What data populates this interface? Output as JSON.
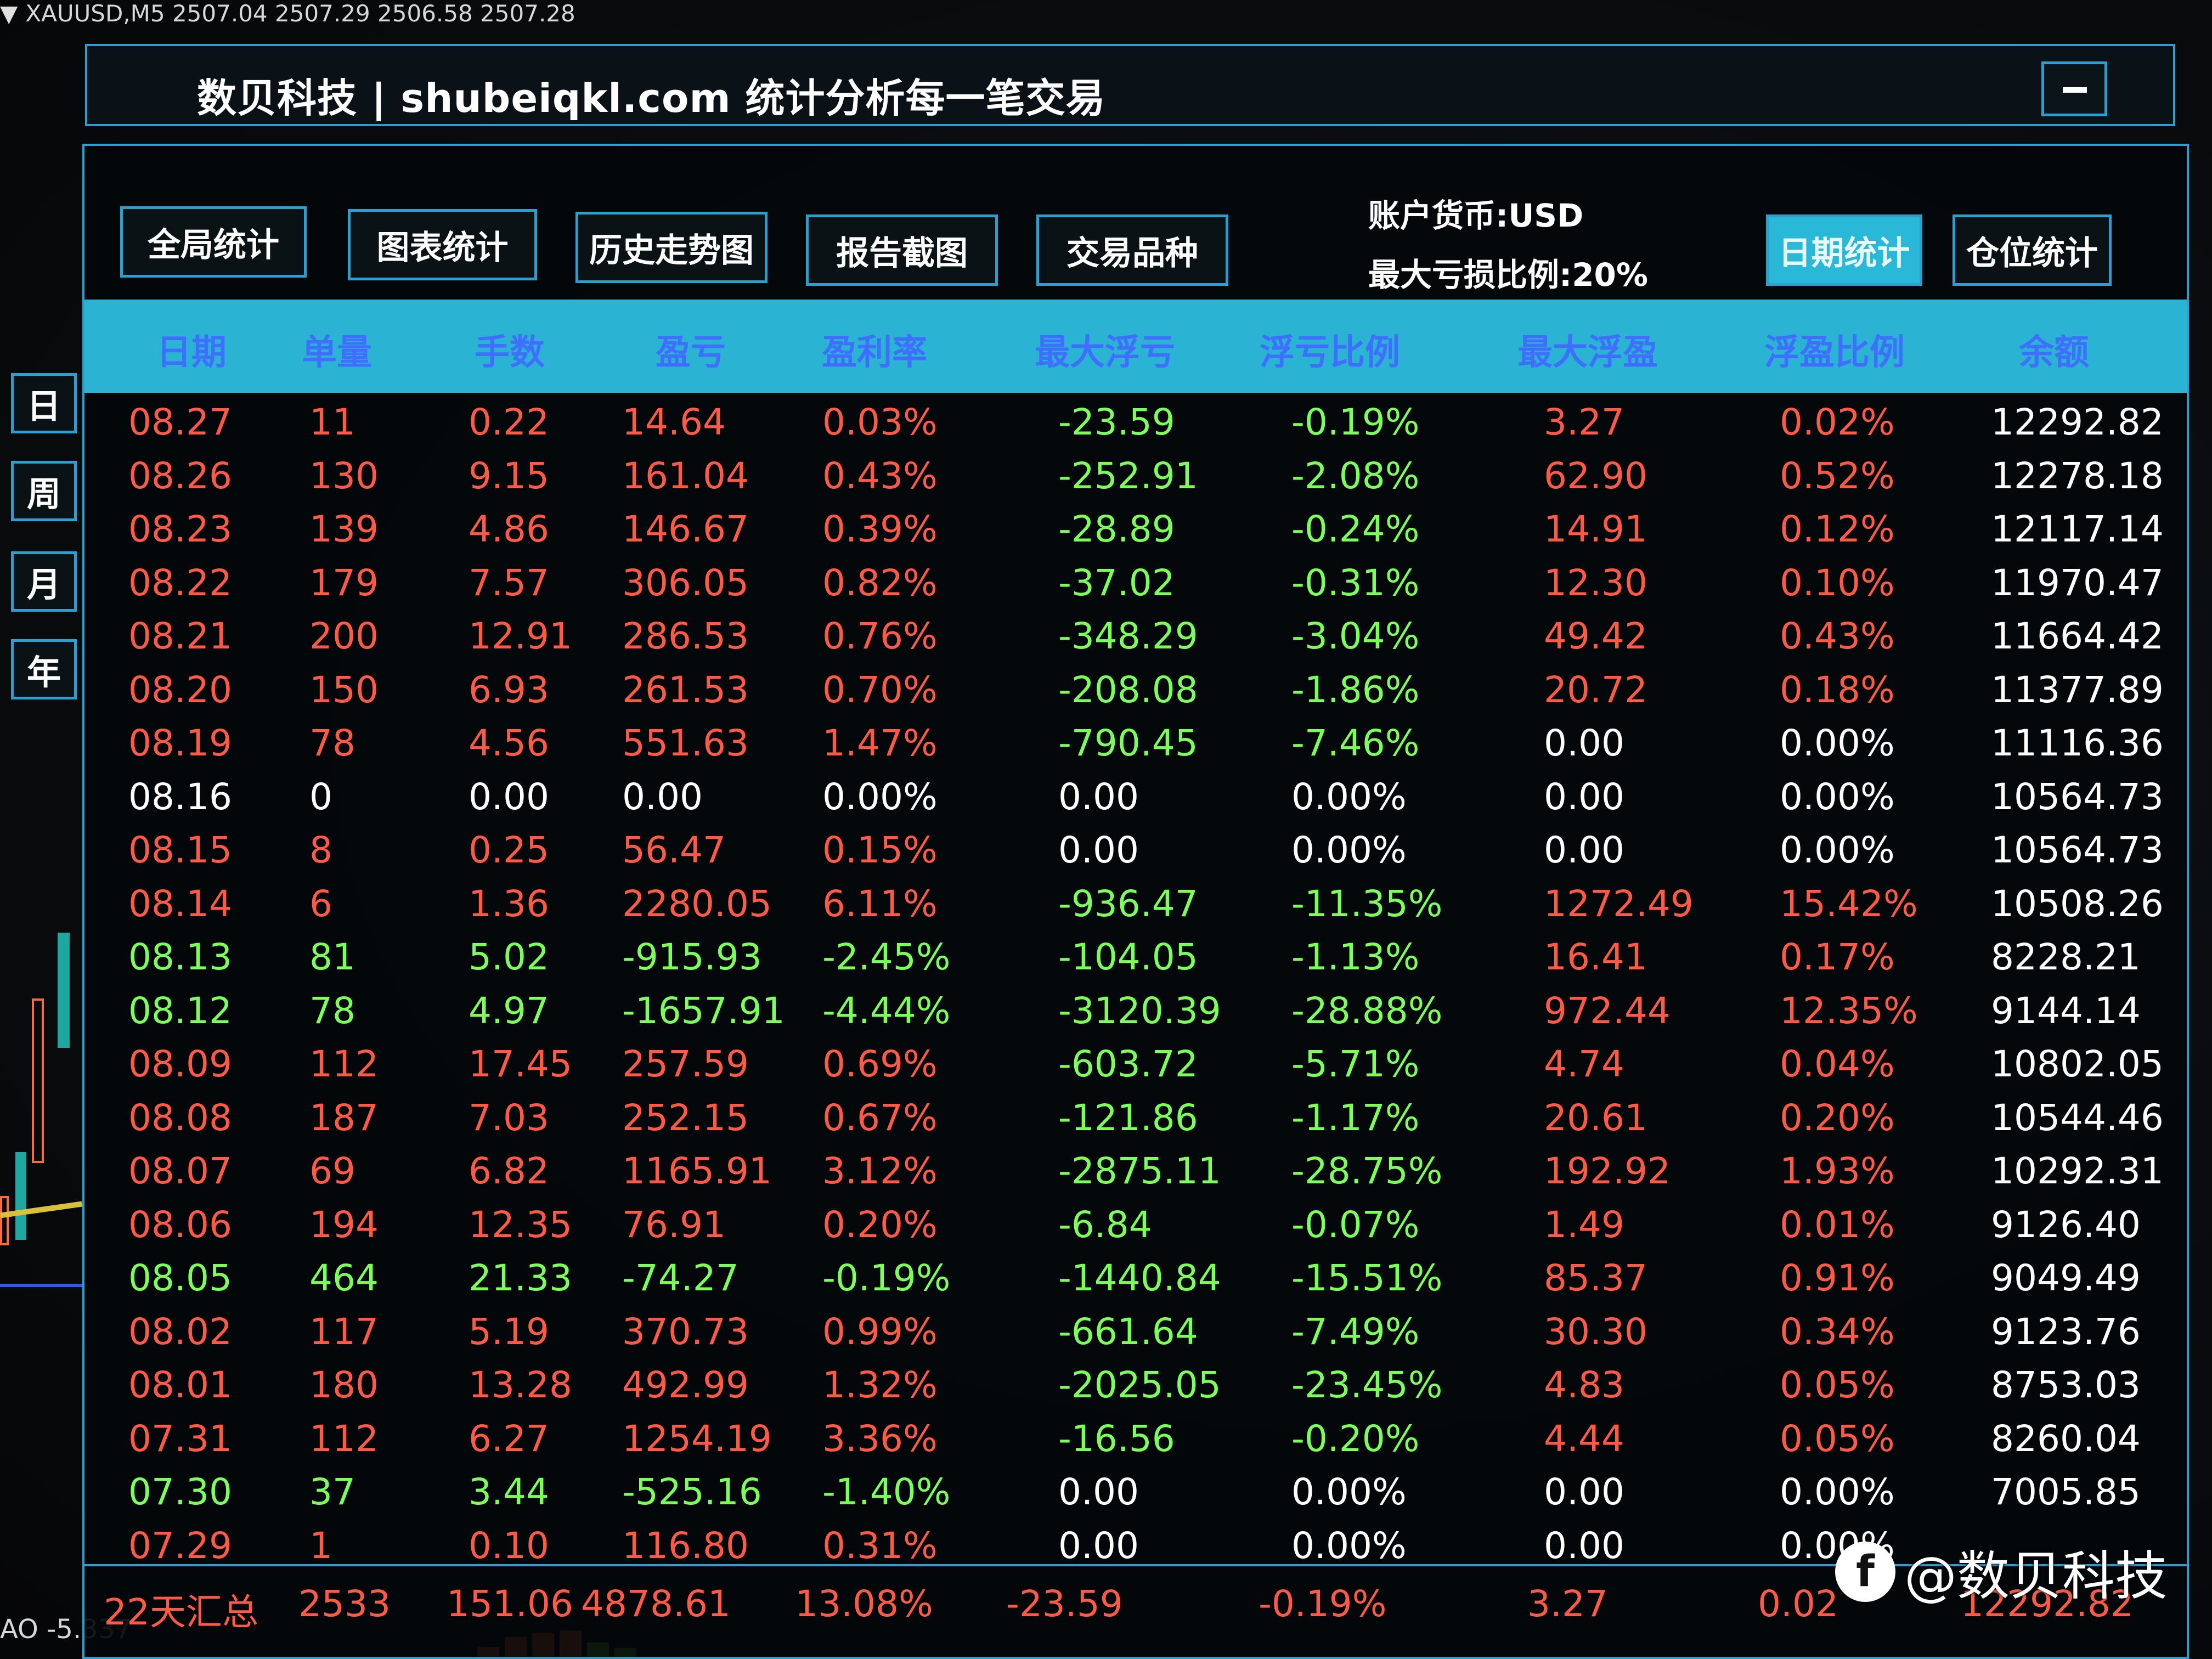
{
  "chart": {
    "symbol_line": "XAUUSD,M5  2507.04 2507.29 2506.58 2507.28",
    "bottom_readout": "AO -5.337"
  },
  "window": {
    "title": "数贝科技 | shubeiqkl.com 统计分析每一笔交易"
  },
  "toolbar": {
    "tabs": [
      "全局统计",
      "图表统计",
      "历史走势图",
      "报告截图",
      "交易品种"
    ],
    "account_currency": "账户货币:USD",
    "max_loss_ratio": "最大亏损比例:20%",
    "right_tabs": [
      "日期统计",
      "仓位统计"
    ]
  },
  "side_periods": [
    "日",
    "周",
    "月",
    "年"
  ],
  "table": {
    "columns": [
      "日期",
      "单量",
      "手数",
      "盈亏",
      "盈利率",
      "最大浮亏",
      "浮亏比例",
      "最大浮盈",
      "浮盈比例",
      "余额"
    ],
    "rows": [
      {
        "color": "red",
        "cells": [
          "08.27",
          "11",
          "0.22",
          "14.64",
          "0.03%",
          "-23.59",
          "-0.19%",
          "3.27",
          "0.02%",
          "12292.82"
        ]
      },
      {
        "color": "red",
        "cells": [
          "08.26",
          "130",
          "9.15",
          "161.04",
          "0.43%",
          "-252.91",
          "-2.08%",
          "62.90",
          "0.52%",
          "12278.18"
        ]
      },
      {
        "color": "red",
        "cells": [
          "08.23",
          "139",
          "4.86",
          "146.67",
          "0.39%",
          "-28.89",
          "-0.24%",
          "14.91",
          "0.12%",
          "12117.14"
        ]
      },
      {
        "color": "red",
        "cells": [
          "08.22",
          "179",
          "7.57",
          "306.05",
          "0.82%",
          "-37.02",
          "-0.31%",
          "12.30",
          "0.10%",
          "11970.47"
        ]
      },
      {
        "color": "red",
        "cells": [
          "08.21",
          "200",
          "12.91",
          "286.53",
          "0.76%",
          "-348.29",
          "-3.04%",
          "49.42",
          "0.43%",
          "11664.42"
        ]
      },
      {
        "color": "red",
        "cells": [
          "08.20",
          "150",
          "6.93",
          "261.53",
          "0.70%",
          "-208.08",
          "-1.86%",
          "20.72",
          "0.18%",
          "11377.89"
        ]
      },
      {
        "color": "red",
        "cells": [
          "08.19",
          "78",
          "4.56",
          "551.63",
          "1.47%",
          "-790.45",
          "-7.46%",
          "0.00",
          "0.00%",
          "11116.36"
        ]
      },
      {
        "color": "white",
        "cells": [
          "08.16",
          "0",
          "0.00",
          "0.00",
          "0.00%",
          "0.00",
          "0.00%",
          "0.00",
          "0.00%",
          "10564.73"
        ]
      },
      {
        "color": "red",
        "cells": [
          "08.15",
          "8",
          "0.25",
          "56.47",
          "0.15%",
          "0.00",
          "0.00%",
          "0.00",
          "0.00%",
          "10564.73"
        ]
      },
      {
        "color": "red",
        "cells": [
          "08.14",
          "6",
          "1.36",
          "2280.05",
          "6.11%",
          "-936.47",
          "-11.35%",
          "1272.49",
          "15.42%",
          "10508.26"
        ]
      },
      {
        "color": "green",
        "cells": [
          "08.13",
          "81",
          "5.02",
          "-915.93",
          "-2.45%",
          "-104.05",
          "-1.13%",
          "16.41",
          "0.17%",
          "8228.21"
        ]
      },
      {
        "color": "green",
        "cells": [
          "08.12",
          "78",
          "4.97",
          "-1657.91",
          "-4.44%",
          "-3120.39",
          "-28.88%",
          "972.44",
          "12.35%",
          "9144.14"
        ]
      },
      {
        "color": "red",
        "cells": [
          "08.09",
          "112",
          "17.45",
          "257.59",
          "0.69%",
          "-603.72",
          "-5.71%",
          "4.74",
          "0.04%",
          "10802.05"
        ]
      },
      {
        "color": "red",
        "cells": [
          "08.08",
          "187",
          "7.03",
          "252.15",
          "0.67%",
          "-121.86",
          "-1.17%",
          "20.61",
          "0.20%",
          "10544.46"
        ]
      },
      {
        "color": "red",
        "cells": [
          "08.07",
          "69",
          "6.82",
          "1165.91",
          "3.12%",
          "-2875.11",
          "-28.75%",
          "192.92",
          "1.93%",
          "10292.31"
        ]
      },
      {
        "color": "red",
        "cells": [
          "08.06",
          "194",
          "12.35",
          "76.91",
          "0.20%",
          "-6.84",
          "-0.07%",
          "1.49",
          "0.01%",
          "9126.40"
        ]
      },
      {
        "color": "green",
        "cells": [
          "08.05",
          "464",
          "21.33",
          "-74.27",
          "-0.19%",
          "-1440.84",
          "-15.51%",
          "85.37",
          "0.91%",
          "9049.49"
        ]
      },
      {
        "color": "red",
        "cells": [
          "08.02",
          "117",
          "5.19",
          "370.73",
          "0.99%",
          "-661.64",
          "-7.49%",
          "30.30",
          "0.34%",
          "9123.76"
        ]
      },
      {
        "color": "red",
        "cells": [
          "08.01",
          "180",
          "13.28",
          "492.99",
          "1.32%",
          "-2025.05",
          "-23.45%",
          "4.83",
          "0.05%",
          "8753.03"
        ]
      },
      {
        "color": "red",
        "cells": [
          "07.31",
          "112",
          "6.27",
          "1254.19",
          "3.36%",
          "-16.56",
          "-0.20%",
          "4.44",
          "0.05%",
          "8260.04"
        ]
      },
      {
        "color": "green",
        "cells": [
          "07.30",
          "37",
          "3.44",
          "-525.16",
          "-1.40%",
          "0.00",
          "0.00%",
          "0.00",
          "0.00%",
          "7005.85"
        ]
      },
      {
        "color": "red",
        "cells": [
          "07.29",
          "1",
          "0.10",
          "116.80",
          "0.31%",
          "0.00",
          "0.00%",
          "0.00",
          "0.00%",
          ""
        ]
      }
    ],
    "summary": [
      "22天汇总",
      "2533",
      "151.06",
      "4878.61",
      "13.08%",
      "-23.59",
      "-0.19%",
      "3.27",
      "0.02",
      "12292.82"
    ]
  },
  "watermark": {
    "logo_glyph": "f",
    "text": "@数贝科技"
  },
  "colors": {
    "accent": "#2a9fd0",
    "header_band": "#2bb3d3",
    "header_text": "#3f6fff",
    "profit": "#ff5a45",
    "loss": "#7cff5a",
    "neutral": "#ffffff"
  }
}
